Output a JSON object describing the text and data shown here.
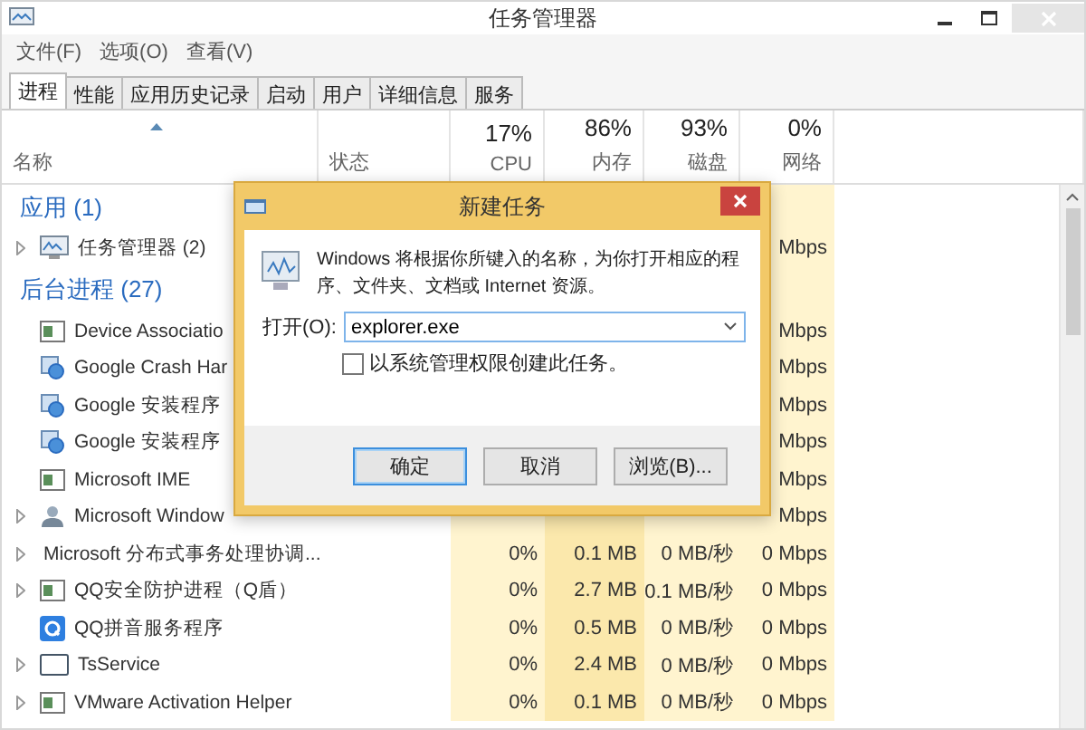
{
  "window": {
    "title": "任务管理器"
  },
  "menu": [
    "文件(F)",
    "选项(O)",
    "查看(V)"
  ],
  "tabs": [
    {
      "label": "进程",
      "selected": true
    },
    {
      "label": "性能",
      "selected": false
    },
    {
      "label": "应用历史记录",
      "selected": false
    },
    {
      "label": "启动",
      "selected": false
    },
    {
      "label": "用户",
      "selected": false
    },
    {
      "label": "详细信息",
      "selected": false
    },
    {
      "label": "服务",
      "selected": false
    }
  ],
  "columns": [
    {
      "label": "名称",
      "sorted": true
    },
    {
      "label": "状态"
    },
    {
      "usage": "17%",
      "label": "CPU"
    },
    {
      "usage": "86%",
      "label": "内存"
    },
    {
      "usage": "93%",
      "label": "磁盘"
    },
    {
      "usage": "0%",
      "label": "网络"
    }
  ],
  "groups": [
    {
      "title": "应用 (1)",
      "rows": [
        {
          "name": "任务管理器 (2)",
          "kind": "taskmgr",
          "expandable": true,
          "net": "Mbps"
        }
      ]
    },
    {
      "title": "后台进程 (27)",
      "rows": [
        {
          "name": "Device Associatio",
          "kind": "window",
          "expandable": false,
          "net": "Mbps"
        },
        {
          "name": "Google Crash Har",
          "kind": "installer",
          "expandable": false,
          "net": "Mbps"
        },
        {
          "name": "Google 安装程序",
          "kind": "installer",
          "expandable": false,
          "net": "Mbps"
        },
        {
          "name": "Google 安装程序",
          "kind": "installer",
          "expandable": false,
          "net": "Mbps"
        },
        {
          "name": "Microsoft IME",
          "kind": "window",
          "expandable": false,
          "net": "Mbps"
        },
        {
          "name": "Microsoft Window",
          "kind": "user",
          "expandable": true,
          "net": "Mbps"
        },
        {
          "name": "Microsoft 分布式事务处理协调...",
          "kind": "network",
          "expandable": true,
          "cpu": "0%",
          "mem": "0.1 MB",
          "disk": "0 MB/秒",
          "net": "0 Mbps"
        },
        {
          "name": "QQ安全防护进程（Q盾）",
          "kind": "window",
          "expandable": true,
          "cpu": "0%",
          "mem": "2.7 MB",
          "disk": "0.1 MB/秒",
          "net": "0 Mbps"
        },
        {
          "name": "QQ拼音服务程序",
          "kind": "q",
          "expandable": false,
          "cpu": "0%",
          "mem": "0.5 MB",
          "disk": "0 MB/秒",
          "net": "0 Mbps"
        },
        {
          "name": "TsService",
          "kind": "monitor",
          "expandable": true,
          "cpu": "0%",
          "mem": "2.4 MB",
          "disk": "0 MB/秒",
          "net": "0 Mbps"
        },
        {
          "name": "VMware Activation Helper",
          "kind": "window",
          "expandable": true,
          "cpu": "0%",
          "mem": "0.1 MB",
          "disk": "0 MB/秒",
          "net": "0 Mbps"
        }
      ]
    }
  ],
  "dialog": {
    "title": "新建任务",
    "message": "Windows 将根据你所键入的名称，为你打开相应的程序、文件夹、文档或 Internet 资源。",
    "open_label": "打开(O):",
    "value": "explorer.exe",
    "checkbox": {
      "label": "以系统管理权限创建此任务。",
      "checked": false
    },
    "buttons": [
      {
        "label": "确定",
        "default": true
      },
      {
        "label": "取消",
        "default": false
      },
      {
        "label": "浏览(B)...",
        "default": false
      }
    ]
  }
}
